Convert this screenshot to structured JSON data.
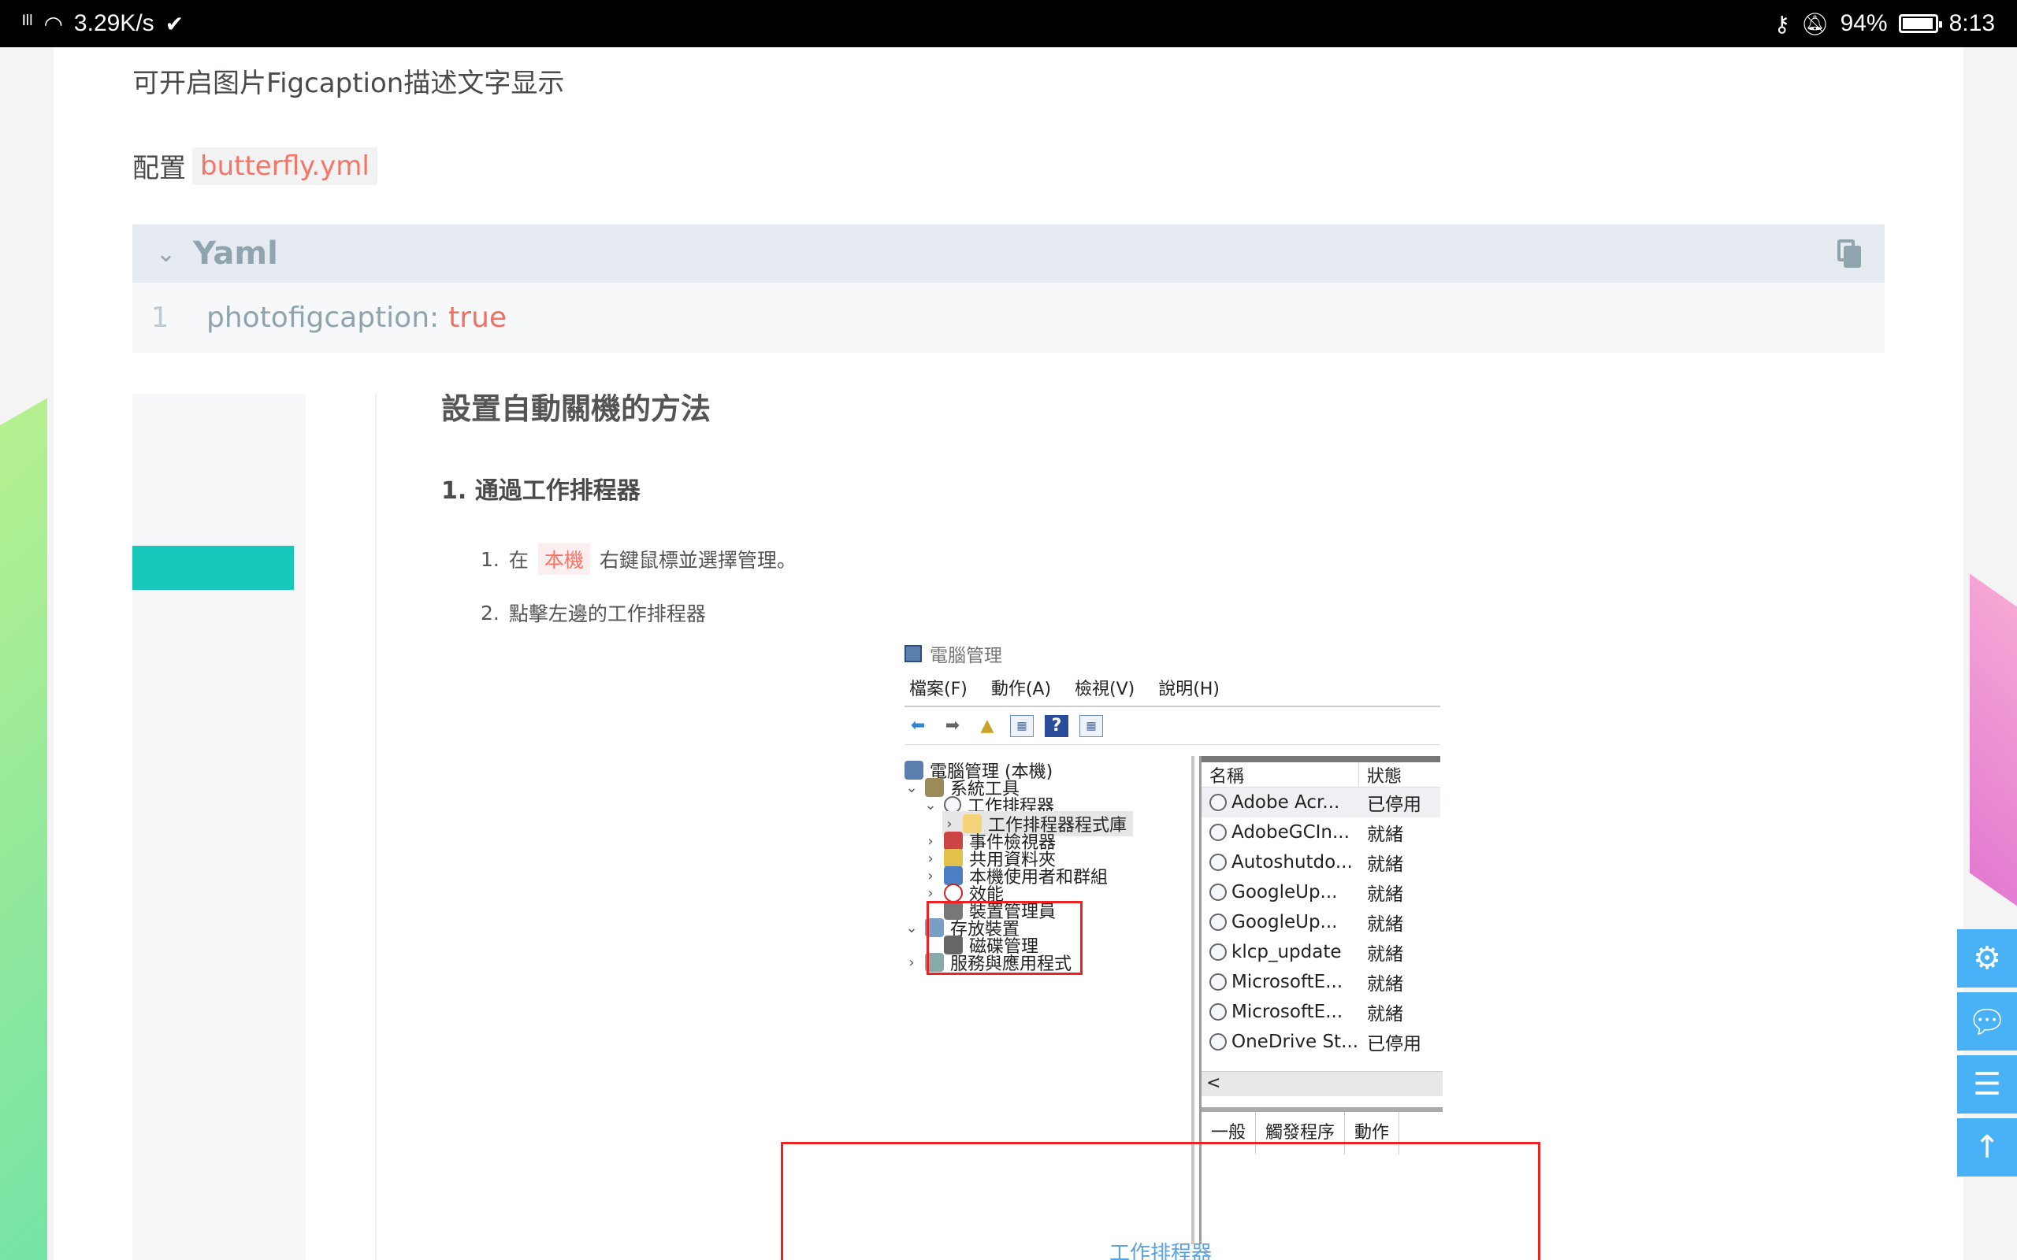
{
  "status_bar": {
    "signal": "⁴⁶ᵢₗₗ",
    "speed": "3.29K/s",
    "battery_pct": "94%",
    "time": "8:13"
  },
  "post": {
    "paragraph_1": "可开启图片Figcaption描述文字显示",
    "config_label": "配置",
    "config_file": "butterfly.yml",
    "code_block": {
      "language": "Yaml",
      "line_number": "1",
      "key": "photofigcaption:",
      "value": "true"
    }
  },
  "screenshot": {
    "title": "設置自動關機的方法",
    "heading": "1. 通過工作排程器",
    "steps": [
      {
        "num": "1.",
        "before": "在",
        "tag": "本機",
        "after": "右鍵鼠標並選擇管理。"
      },
      {
        "num": "2.",
        "text": "點擊左邊的工作排程器"
      }
    ],
    "window": {
      "title": "電腦管理",
      "menus": [
        "檔案(F)",
        "動作(A)",
        "檢視(V)",
        "說明(H)"
      ],
      "tree": [
        "電腦管理 (本機)",
        "系統工具",
        "工作排程器",
        "工作排程器程式庫",
        "事件檢視器",
        "共用資料夾",
        "本機使用者和群組",
        "效能",
        "裝置管理員",
        "存放裝置",
        "磁碟管理",
        "服務與應用程式"
      ],
      "columns": [
        "名稱",
        "狀態"
      ],
      "rows": [
        {
          "name": "Adobe Acr...",
          "status": "已停用"
        },
        {
          "name": "AdobeGCIn...",
          "status": "就緒"
        },
        {
          "name": "Autoshutdo...",
          "status": "就緒"
        },
        {
          "name": "GoogleUp...",
          "status": "就緒"
        },
        {
          "name": "GoogleUp...",
          "status": "就緒"
        },
        {
          "name": "klcp_update",
          "status": "就緒"
        },
        {
          "name": "MicrosoftE...",
          "status": "就緒"
        },
        {
          "name": "MicrosoftE...",
          "status": "就緒"
        },
        {
          "name": "OneDrive St...",
          "status": "已停用"
        }
      ],
      "scroll_arrow": "<",
      "bottom_tabs": [
        "一般",
        "觸發程序",
        "動作"
      ]
    },
    "caption": "工作排程器"
  },
  "fab_buttons": [
    "gear-icon",
    "chat-icon",
    "list-icon",
    "arrow-up-icon"
  ]
}
